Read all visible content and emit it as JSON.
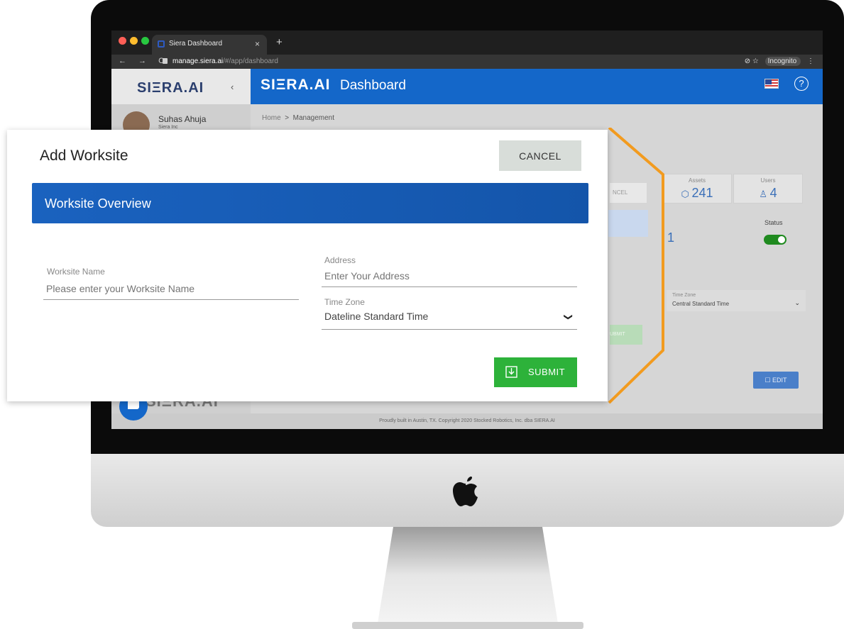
{
  "browser": {
    "tab_title": "Siera Dashboard",
    "tab_close": "×",
    "new_tab": "+",
    "nav_icons": "← → C",
    "url_host": "manage.siera.ai",
    "url_path": "/#/app/dashboard",
    "right_icons": "⊘ ☆",
    "incognito_label": "Incognito",
    "menu": "⋮"
  },
  "app": {
    "sidebar_logo": "SIΞRA.AI",
    "collapse": "‹",
    "header_logo": "SIΞRA.AI",
    "header_title": "Dashboard",
    "help": "?",
    "user_name": "Suhas Ahuja",
    "user_org": "Siera Inc",
    "bottom_logo": "SIΞRA.AI",
    "breadcrumb_home": "Home",
    "breadcrumb_sep": ">",
    "breadcrumb_current": "Management",
    "footer": "Proudly built in Austin, TX. Copyright 2020 Stocked Robotics, Inc. dba SIERA.AI"
  },
  "dashboard": {
    "assets_label": "Assets",
    "assets_value": "241",
    "users_label": "Users",
    "users_value": "4",
    "status_label": "Status",
    "time_zone_label": "Time Zone",
    "time_zone_value": "Central Standard Time",
    "edit_label": "EDIT",
    "fragment_cancel": "NCEL",
    "fragment_submit": "UBMIT",
    "fragment_value": "1"
  },
  "modal": {
    "title": "Add Worksite",
    "cancel_label": "CANCEL",
    "section_title": "Worksite Overview",
    "worksite_name_label": "Worksite Name",
    "worksite_name_placeholder": "Please enter your Worksite Name",
    "address_label": "Address",
    "address_placeholder": "Enter Your Address",
    "time_zone_label": "Time Zone",
    "time_zone_value": "Dateline Standard Time",
    "submit_label": "SUBMIT"
  },
  "colors": {
    "brand_blue": "#1467c9",
    "submit_green": "#2db23a",
    "zoom_frame_orange": "#f29b1f"
  }
}
